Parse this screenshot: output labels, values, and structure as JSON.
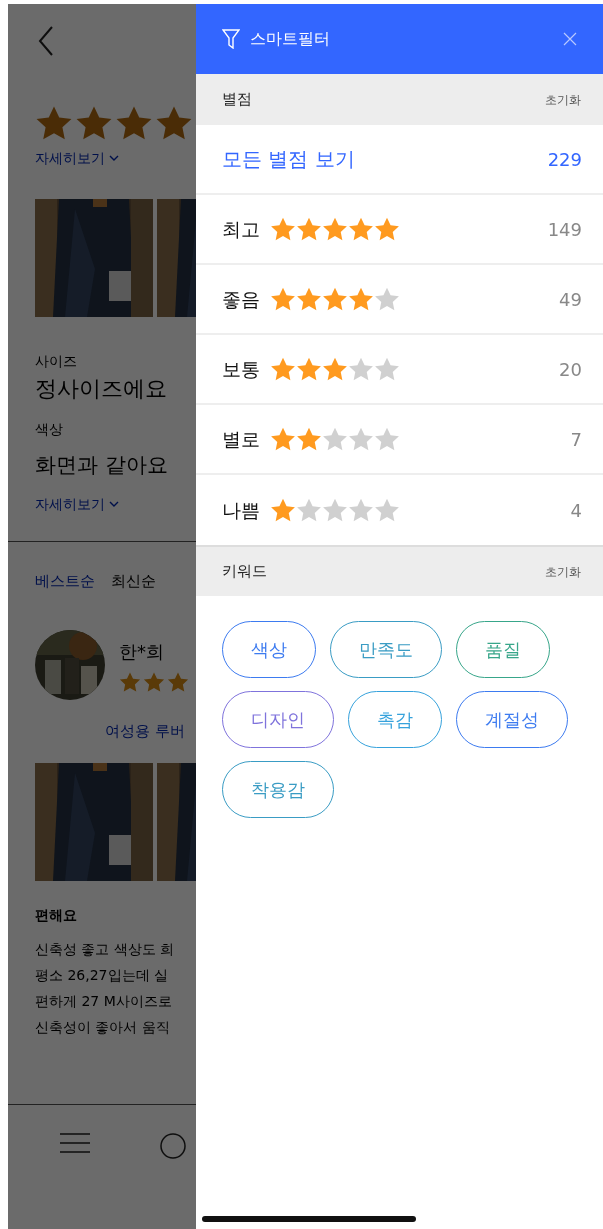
{
  "background_page": {
    "rating": {
      "stars": 4
    },
    "details_link": "자세히보기",
    "attributes": [
      {
        "label": "사이즈",
        "value": "정사이즈에요"
      },
      {
        "label": "색상",
        "value": "화면과 같아요"
      }
    ],
    "details_link_2": "자세히보기",
    "sort_tabs": [
      {
        "label": "베스트순",
        "selected": true
      },
      {
        "label": "최신순",
        "selected": false
      }
    ],
    "review": {
      "author": "한*희",
      "stars": 3,
      "option": "여성용 루버",
      "title": "편해요",
      "body_lines": [
        "신축성 좋고 색상도 희",
        "평소 26,27입는데 실",
        "편하게 27 M사이즈로",
        "신축성이 좋아서 움직"
      ]
    }
  },
  "drawer": {
    "title": "스마트필터",
    "rating_section": {
      "title": "별점",
      "reset": "초기화",
      "rows": [
        {
          "kind": "all",
          "label": "모든 별점 보기",
          "count": "229"
        },
        {
          "kind": "stars",
          "label": "최고",
          "stars": 5,
          "count": "149"
        },
        {
          "kind": "stars",
          "label": "좋음",
          "stars": 4,
          "count": "49"
        },
        {
          "kind": "stars",
          "label": "보통",
          "stars": 3,
          "count": "20"
        },
        {
          "kind": "stars",
          "label": "별로",
          "stars": 2,
          "count": "7"
        },
        {
          "kind": "stars",
          "label": "나쁨",
          "stars": 1,
          "count": "4"
        }
      ]
    },
    "keyword_section": {
      "title": "키워드",
      "reset": "초기화",
      "keywords": [
        {
          "label": "색상",
          "color": "#3d7bf0"
        },
        {
          "label": "만족도",
          "color": "#3a9cc4"
        },
        {
          "label": "품질",
          "color": "#38a68a"
        },
        {
          "label": "디자인",
          "color": "#7f73dc"
        },
        {
          "label": "촉감",
          "color": "#36a2dc"
        },
        {
          "label": "계절성",
          "color": "#3d7bf0"
        },
        {
          "label": "착용감",
          "color": "#3a9cc4"
        }
      ]
    }
  }
}
